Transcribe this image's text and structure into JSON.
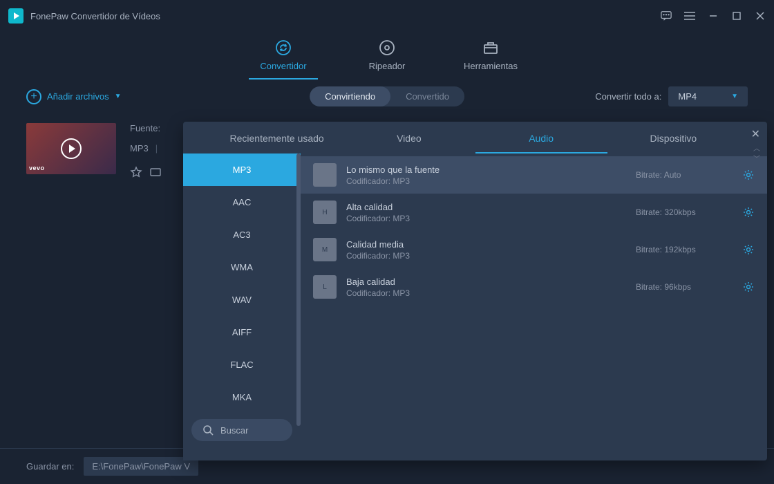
{
  "app": {
    "title": "FonePaw Convertidor de Vídeos"
  },
  "main_tabs": {
    "converter": "Convertidor",
    "ripper": "Ripeador",
    "tools": "Herramientas"
  },
  "toolbar": {
    "add_files": "Añadir archivos",
    "status_converting": "Convirtiendo",
    "status_converted": "Convertido",
    "convert_all_label": "Convertir todo a:",
    "selected_format": "MP4"
  },
  "file": {
    "source_label": "Fuente:",
    "format": "MP3",
    "vevo": "vevo"
  },
  "popup": {
    "tabs": {
      "recent": "Recientemente usado",
      "video": "Video",
      "audio": "Audio",
      "device": "Dispositivo"
    },
    "codecs": [
      "MP3",
      "AAC",
      "AC3",
      "WMA",
      "WAV",
      "AIFF",
      "FLAC",
      "MKA"
    ],
    "search_label": "Buscar",
    "presets": [
      {
        "title": "Lo mismo que la fuente",
        "encoder": "Codificador: MP3",
        "bitrate": "Bitrate: Auto",
        "icon": ""
      },
      {
        "title": "Alta calidad",
        "encoder": "Codificador: MP3",
        "bitrate": "Bitrate: 320kbps",
        "icon": "H"
      },
      {
        "title": "Calidad media",
        "encoder": "Codificador: MP3",
        "bitrate": "Bitrate: 192kbps",
        "icon": "M"
      },
      {
        "title": "Baja calidad",
        "encoder": "Codificador: MP3",
        "bitrate": "Bitrate: 96kbps",
        "icon": "L"
      }
    ]
  },
  "footer": {
    "save_label": "Guardar en:",
    "save_path": "E:\\FonePaw\\FonePaw V"
  }
}
